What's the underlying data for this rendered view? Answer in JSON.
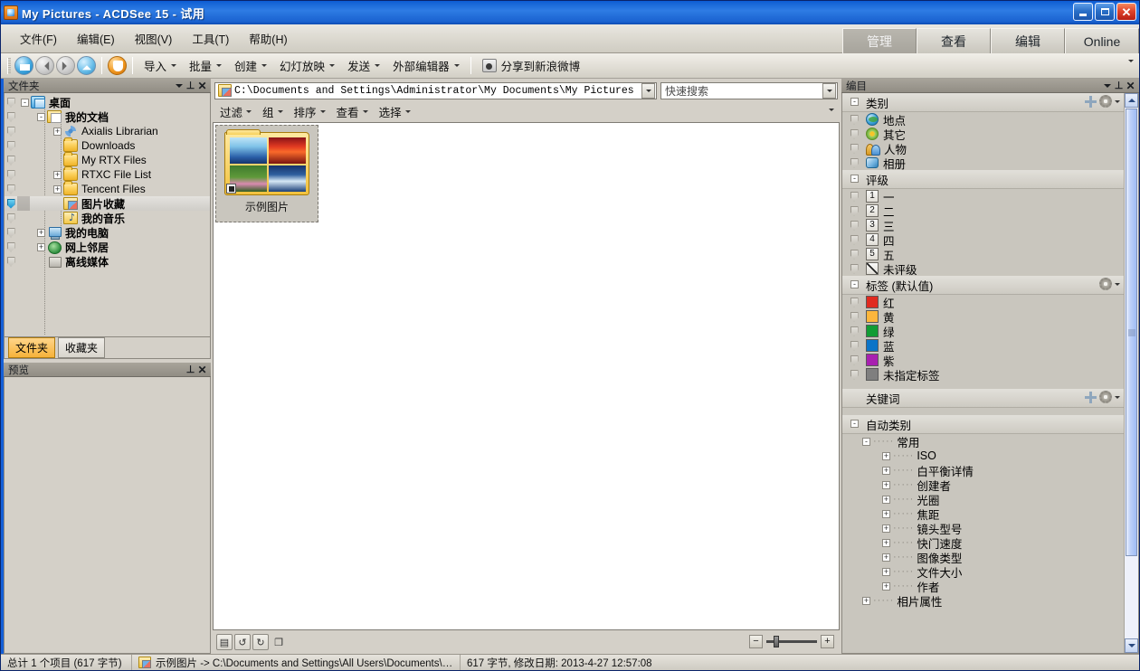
{
  "window": {
    "title": "My Pictures - ACDSee 15 - 试用",
    "icon": "acdsee-icon",
    "controls": {
      "minimize": "minimize",
      "maximize": "maximize",
      "close": "close"
    }
  },
  "menu": {
    "items": [
      {
        "label": "文件(F)",
        "name": "menu-file"
      },
      {
        "label": "编辑(E)",
        "name": "menu-edit"
      },
      {
        "label": "视图(V)",
        "name": "menu-view"
      },
      {
        "label": "工具(T)",
        "name": "menu-tools"
      },
      {
        "label": "帮助(H)",
        "name": "menu-help"
      }
    ]
  },
  "mode_tabs": [
    {
      "label": "管理",
      "active": true
    },
    {
      "label": "查看",
      "active": false
    },
    {
      "label": "编辑",
      "active": false
    },
    {
      "label": "Online",
      "active": false
    }
  ],
  "toolbar": {
    "nav": [
      {
        "name": "home-icon",
        "label": "主页"
      },
      {
        "name": "back-icon",
        "label": "后退"
      },
      {
        "name": "forward-icon",
        "label": "前进"
      },
      {
        "name": "up-icon",
        "label": "向上"
      },
      {
        "name": "acdsee-orange-icon",
        "label": "ACDSee"
      }
    ],
    "items": [
      {
        "label": "导入",
        "name": "import"
      },
      {
        "label": "批量",
        "name": "batch"
      },
      {
        "label": "创建",
        "name": "create"
      },
      {
        "label": "幻灯放映",
        "name": "slideshow"
      },
      {
        "label": "发送",
        "name": "send"
      },
      {
        "label": "外部编辑器",
        "name": "external-editor"
      }
    ],
    "share": {
      "label": "分享到新浪微博",
      "icon": "weibo-icon"
    }
  },
  "folders_pane": {
    "title": "文件夹",
    "tree": [
      {
        "label": "桌面",
        "indent": 0,
        "expander": "-",
        "icon": "desktop-icon",
        "bold": true,
        "selected": false
      },
      {
        "label": "我的文档",
        "indent": 1,
        "expander": "-",
        "icon": "my-documents-icon",
        "bold": true,
        "selected": false
      },
      {
        "label": "Axialis Librarian",
        "indent": 2,
        "expander": "+",
        "icon": "axialis-icon",
        "bold": false,
        "selected": false
      },
      {
        "label": "Downloads",
        "indent": 2,
        "expander": "",
        "icon": "folder-icon",
        "bold": false,
        "selected": false
      },
      {
        "label": "My RTX Files",
        "indent": 2,
        "expander": "",
        "icon": "folder-icon",
        "bold": false,
        "selected": false
      },
      {
        "label": "RTXC File List",
        "indent": 2,
        "expander": "+",
        "icon": "folder-icon",
        "bold": false,
        "selected": false
      },
      {
        "label": "Tencent Files",
        "indent": 2,
        "expander": "+",
        "icon": "folder-icon",
        "bold": false,
        "selected": false
      },
      {
        "label": "图片收藏",
        "indent": 2,
        "expander": "",
        "icon": "pictures-folder-icon",
        "bold": true,
        "selected": true
      },
      {
        "label": "我的音乐",
        "indent": 2,
        "expander": "",
        "icon": "music-folder-icon",
        "bold": true,
        "selected": false
      },
      {
        "label": "我的电脑",
        "indent": 1,
        "expander": "+",
        "icon": "my-computer-icon",
        "bold": true,
        "selected": false
      },
      {
        "label": "网上邻居",
        "indent": 1,
        "expander": "+",
        "icon": "network-icon",
        "bold": true,
        "selected": false
      },
      {
        "label": "离线媒体",
        "indent": 1,
        "expander": "",
        "icon": "offline-media-icon",
        "bold": true,
        "selected": false
      }
    ],
    "tabs": [
      {
        "label": "文件夹",
        "active": true
      },
      {
        "label": "收藏夹",
        "active": false
      }
    ]
  },
  "preview_pane": {
    "title": "预览"
  },
  "address_bar": {
    "path": "C:\\Documents and Settings\\Administrator\\My Documents\\My Pictures",
    "icon": "pictures-folder-icon"
  },
  "search": {
    "placeholder": "快速搜索",
    "value": ""
  },
  "view_toolbar": [
    {
      "label": "过滤",
      "name": "filter"
    },
    {
      "label": "组",
      "name": "group"
    },
    {
      "label": "排序",
      "name": "sort"
    },
    {
      "label": "查看",
      "name": "view"
    },
    {
      "label": "选择",
      "name": "select"
    }
  ],
  "file_list": {
    "items": [
      {
        "label": "示例图片",
        "type": "folder-thumbnail",
        "selected": false
      }
    ]
  },
  "zoom_bar": {
    "buttons": [
      "rotate-preview-icon",
      "rotate-left-icon",
      "rotate-right-icon",
      "window-icon"
    ],
    "minus": "−",
    "plus": "+",
    "level": 35
  },
  "catalog_pane": {
    "title": "编目",
    "sections": [
      {
        "name": "categories",
        "header": "类别",
        "expander": "-",
        "has_add": true,
        "has_options": true,
        "rows": [
          {
            "label": "地点",
            "icon": "globe-icon"
          },
          {
            "label": "其它",
            "icon": "flower-icon"
          },
          {
            "label": "人物",
            "icon": "people-icon"
          },
          {
            "label": "相册",
            "icon": "album-icon"
          }
        ]
      },
      {
        "name": "ratings",
        "header": "评级",
        "expander": "-",
        "has_add": false,
        "has_options": false,
        "rows": [
          {
            "label": "一",
            "badge": "1"
          },
          {
            "label": "二",
            "badge": "2"
          },
          {
            "label": "三",
            "badge": "3"
          },
          {
            "label": "四",
            "badge": "4"
          },
          {
            "label": "五",
            "badge": "5"
          },
          {
            "label": "未评级",
            "badge": "none"
          }
        ]
      },
      {
        "name": "labels",
        "header": "标签 (默认值)",
        "expander": "-",
        "has_add": false,
        "has_options": true,
        "rows": [
          {
            "label": "红",
            "color": "#e02b20"
          },
          {
            "label": "黄",
            "color": "#fcb63c"
          },
          {
            "label": "绿",
            "color": "#119c34"
          },
          {
            "label": "蓝",
            "color": "#0b74c8"
          },
          {
            "label": "紫",
            "color": "#a820b0"
          },
          {
            "label": "未指定标签",
            "color": "#7f7f7f"
          }
        ]
      },
      {
        "name": "keywords",
        "header": "关键词",
        "expander": "",
        "has_add": true,
        "has_options": true,
        "rows": []
      },
      {
        "name": "auto-categories",
        "header": "自动类别",
        "expander": "-",
        "has_add": false,
        "has_options": false,
        "rows": []
      }
    ],
    "auto_tree": [
      {
        "label": "常用",
        "indent": 0,
        "expander": "-"
      },
      {
        "label": "ISO",
        "indent": 1,
        "expander": "+"
      },
      {
        "label": "白平衡详情",
        "indent": 1,
        "expander": "+"
      },
      {
        "label": "创建者",
        "indent": 1,
        "expander": "+"
      },
      {
        "label": "光圈",
        "indent": 1,
        "expander": "+"
      },
      {
        "label": "焦距",
        "indent": 1,
        "expander": "+"
      },
      {
        "label": "镜头型号",
        "indent": 1,
        "expander": "+"
      },
      {
        "label": "快门速度",
        "indent": 1,
        "expander": "+"
      },
      {
        "label": "图像类型",
        "indent": 1,
        "expander": "+"
      },
      {
        "label": "文件大小",
        "indent": 1,
        "expander": "+"
      },
      {
        "label": "作者",
        "indent": 1,
        "expander": "+"
      },
      {
        "label": "相片属性",
        "indent": 0,
        "expander": "+"
      }
    ]
  },
  "status_bar": {
    "total": "总计 1 个项目 (617 字节)",
    "selection_path": "示例图片 -> C:\\Documents and Settings\\All Users\\Documents\\My...",
    "details": "617 字节, 修改日期: 2013-4-27 12:57:08"
  },
  "colors": {
    "titlebar": "#1564d6",
    "accent": "#1560d8",
    "panel": "#d4d0c8",
    "pane_header": "#918d84",
    "selected_tab": "#f6b23a"
  }
}
